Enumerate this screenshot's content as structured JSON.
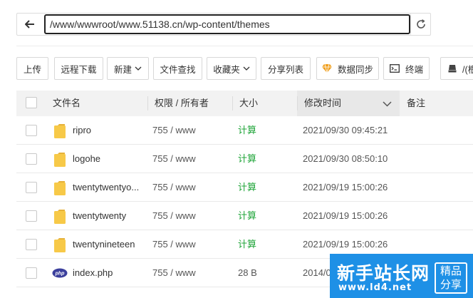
{
  "path_bar": {
    "path": "/www/wwwroot/www.51138.cn/wp-content/themes"
  },
  "toolbar": {
    "upload": "上传",
    "remote_download": "远程下载",
    "new": "新建",
    "file_search": "文件查找",
    "favorites": "收藏夹",
    "share_list": "分享列表",
    "data_sync": "数据同步",
    "terminal": "终端",
    "disk": "/(根"
  },
  "table": {
    "headers": {
      "name": "文件名",
      "perm": "权限 / 所有者",
      "size": "大小",
      "mtime": "修改时间",
      "note": "备注"
    },
    "rows": [
      {
        "type": "folder",
        "name": "ripro",
        "perm": "755 / www",
        "size": "计算",
        "mtime": "2021/09/30 09:45:21"
      },
      {
        "type": "folder",
        "name": "logohe",
        "perm": "755 / www",
        "size": "计算",
        "mtime": "2021/09/30 08:50:10"
      },
      {
        "type": "folder",
        "name": "twentytwentyo...",
        "perm": "755 / www",
        "size": "计算",
        "mtime": "2021/09/19 15:00:26"
      },
      {
        "type": "folder",
        "name": "twentytwenty",
        "perm": "755 / www",
        "size": "计算",
        "mtime": "2021/09/19 15:00:26"
      },
      {
        "type": "folder",
        "name": "twentynineteen",
        "perm": "755 / www",
        "size": "计算",
        "mtime": "2021/09/19 15:00:26"
      },
      {
        "type": "php",
        "name": "index.php",
        "perm": "755 / www",
        "size": "28 B",
        "mtime": "2014/0"
      }
    ]
  },
  "icons": {
    "php_label": "php"
  },
  "watermark": {
    "title": "新手站长网",
    "url": "www.ld4.net",
    "badge": "精品分享"
  },
  "colors": {
    "accent_green": "#20a53a",
    "folder_yellow": "#f7c948",
    "watermark_blue": "#1e90e6"
  }
}
